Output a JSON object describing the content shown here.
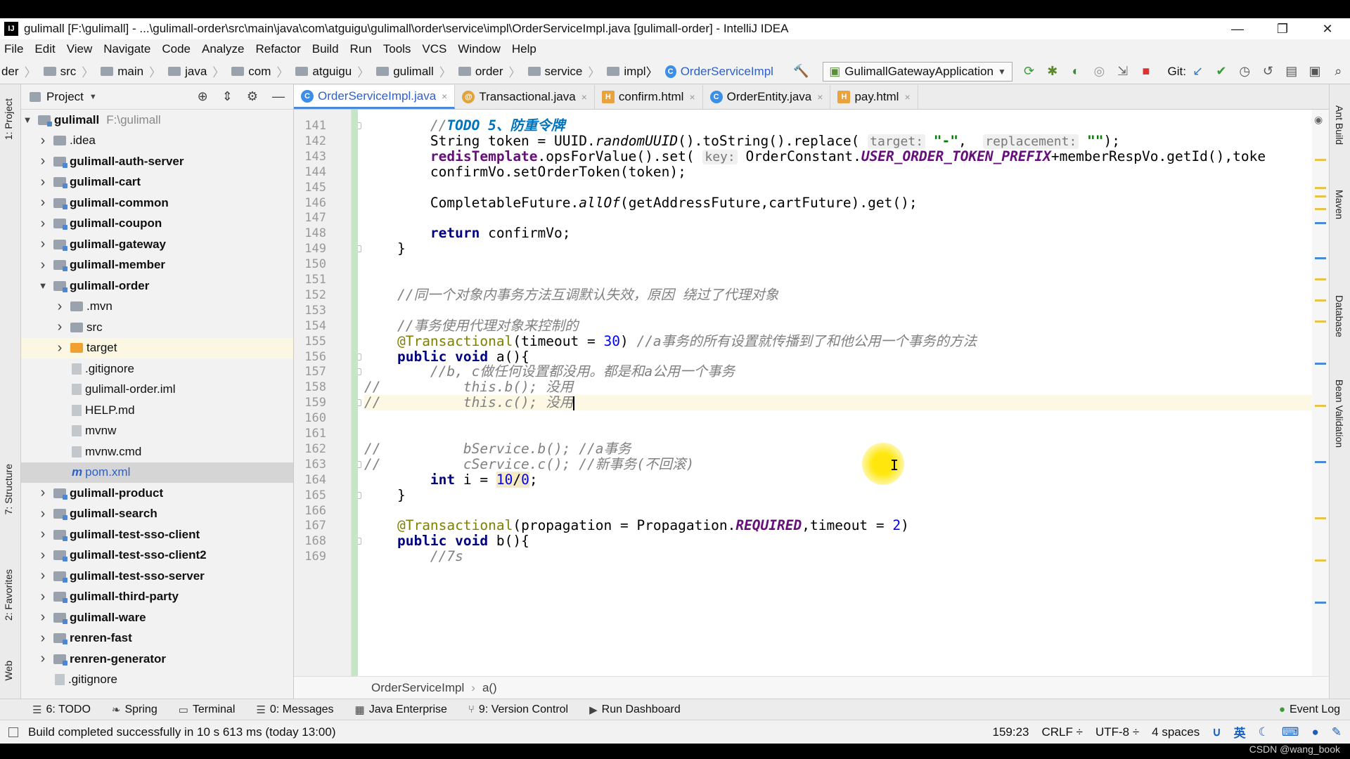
{
  "window": {
    "title": "gulimall [F:\\gulimall] - ...\\gulimall-order\\src\\main\\java\\com\\atguigu\\gulimall\\order\\service\\impl\\OrderServiceImpl.java [gulimall-order] - IntelliJ IDEA",
    "app_logo": "IJ",
    "minimize": "—",
    "restore": "❐",
    "close": "✕"
  },
  "menu": [
    "File",
    "Edit",
    "View",
    "Navigate",
    "Code",
    "Analyze",
    "Refactor",
    "Build",
    "Run",
    "Tools",
    "VCS",
    "Window",
    "Help"
  ],
  "nav": {
    "prefix": "der",
    "crumbs": [
      "src",
      "main",
      "java",
      "com",
      "atguigu",
      "gulimall",
      "order",
      "service",
      "impl"
    ],
    "current_class": "OrderServiceImpl",
    "run_config": "GulimallGatewayApplication",
    "git_label": "Git:"
  },
  "project": {
    "header": "Project",
    "root": {
      "name": "gulimall",
      "path": "F:\\gulimall"
    },
    "items": [
      {
        "label": ".idea",
        "kind": "folder",
        "level": 1
      },
      {
        "label": "gulimall-auth-server",
        "kind": "module",
        "level": 1
      },
      {
        "label": "gulimall-cart",
        "kind": "module",
        "level": 1
      },
      {
        "label": "gulimall-common",
        "kind": "module",
        "level": 1
      },
      {
        "label": "gulimall-coupon",
        "kind": "module",
        "level": 1
      },
      {
        "label": "gulimall-gateway",
        "kind": "module",
        "level": 1
      },
      {
        "label": "gulimall-member",
        "kind": "module",
        "level": 1
      },
      {
        "label": "gulimall-order",
        "kind": "module-open",
        "level": 1
      },
      {
        "label": ".mvn",
        "kind": "folder",
        "level": 2
      },
      {
        "label": "src",
        "kind": "folder",
        "level": 2
      },
      {
        "label": "target",
        "kind": "folder-orange",
        "level": 2
      },
      {
        "label": ".gitignore",
        "kind": "file",
        "level": 2
      },
      {
        "label": "gulimall-order.iml",
        "kind": "file",
        "level": 2
      },
      {
        "label": "HELP.md",
        "kind": "file",
        "level": 2
      },
      {
        "label": "mvnw",
        "kind": "file",
        "level": 2
      },
      {
        "label": "mvnw.cmd",
        "kind": "file",
        "level": 2
      },
      {
        "label": "pom.xml",
        "kind": "maven",
        "level": 2
      },
      {
        "label": "gulimall-product",
        "kind": "module",
        "level": 1
      },
      {
        "label": "gulimall-search",
        "kind": "module",
        "level": 1
      },
      {
        "label": "gulimall-test-sso-client",
        "kind": "module",
        "level": 1
      },
      {
        "label": "gulimall-test-sso-client2",
        "kind": "module",
        "level": 1
      },
      {
        "label": "gulimall-test-sso-server",
        "kind": "module",
        "level": 1
      },
      {
        "label": "gulimall-third-party",
        "kind": "module",
        "level": 1
      },
      {
        "label": "gulimall-ware",
        "kind": "module",
        "level": 1
      },
      {
        "label": "renren-fast",
        "kind": "module",
        "level": 1
      },
      {
        "label": "renren-generator",
        "kind": "module",
        "level": 1
      },
      {
        "label": ".gitignore",
        "kind": "file",
        "level": 1
      }
    ]
  },
  "tabs": [
    {
      "label": "OrderServiceImpl.java",
      "icon": "class-icon",
      "active": true
    },
    {
      "label": "Transactional.java",
      "icon": "annotation-icon",
      "active": false
    },
    {
      "label": "confirm.html",
      "icon": "html-icon",
      "active": false
    },
    {
      "label": "OrderEntity.java",
      "icon": "class-icon",
      "active": false
    },
    {
      "label": "pay.html",
      "icon": "html-icon",
      "active": false
    }
  ],
  "editor": {
    "lines": [
      {
        "n": "141",
        "html": "        <span class=\"cm\">//</span><span class=\"todo\">TODO 5、防重令牌</span>"
      },
      {
        "n": "142",
        "html": "        String token = UUID.<span class=\"it\">randomUUID</span>().toString().replace( <span class=\"hint\">target:</span> <span class=\"st\">\"-\"</span>,  <span class=\"hint\">replacement:</span> <span class=\"st\">\"\"</span>);"
      },
      {
        "n": "143",
        "html": "        <span class=\"fld\">redisTemplate</span>.opsForValue().set( <span class=\"hint\">key:</span> OrderConstant.<span class=\"cst\">USER_ORDER_TOKEN_PREFIX</span>+memberRespVo.getId(),toke"
      },
      {
        "n": "144",
        "html": "        confirmVo.setOrderToken(token);"
      },
      {
        "n": "145",
        "html": ""
      },
      {
        "n": "146",
        "html": "        CompletableFuture.<span class=\"it\">allOf</span>(getAddressFuture,cartFuture).get();"
      },
      {
        "n": "147",
        "html": ""
      },
      {
        "n": "148",
        "html": "        <span class=\"kw\">return</span> confirmVo;"
      },
      {
        "n": "149",
        "html": "    }"
      },
      {
        "n": "150",
        "html": ""
      },
      {
        "n": "151",
        "html": ""
      },
      {
        "n": "152",
        "html": "    <span class=\"cm\">//同一个对象内事务方法互调默认失效，原因 绕过了代理对象</span>"
      },
      {
        "n": "153",
        "html": ""
      },
      {
        "n": "154",
        "html": "    <span class=\"cm\">//事务使用代理对象来控制的</span>"
      },
      {
        "n": "155",
        "html": "    <span class=\"an\">@Transactional</span>(timeout = <span class=\"num\">30</span>) <span class=\"cm\">//a事务的所有设置就传播到了和他公用一个事务的方法</span>"
      },
      {
        "n": "156",
        "html": "    <span class=\"kw\">public void</span> a(){"
      },
      {
        "n": "157",
        "html": "        <span class=\"cm\">//b, c做任何设置都没用。都是和a公用一个事务</span>"
      },
      {
        "n": "158",
        "html": "<span class=\"cm\">//          this.b(); 没用</span>"
      },
      {
        "n": "159",
        "html": "<span class=\"cm\">//          this.c(); 没用</span><span class=\"caret\"></span>",
        "current": true
      },
      {
        "n": "160",
        "html": ""
      },
      {
        "n": "161",
        "html": ""
      },
      {
        "n": "162",
        "html": "<span class=\"cm\">//          bService.b(); //a事务</span>"
      },
      {
        "n": "163",
        "html": "<span class=\"cm\">//          cService.c(); //新事务(不回滚)</span>"
      },
      {
        "n": "164",
        "html": "        <span class=\"kw\">int</span> i = <span class=\"warnbg\"><span class=\"num\">10</span>/<span class=\"num\">0</span></span>;"
      },
      {
        "n": "165",
        "html": "    }"
      },
      {
        "n": "166",
        "html": ""
      },
      {
        "n": "167",
        "html": "    <span class=\"an\">@Transactional</span>(propagation = Propagation.<span class=\"cst\">REQUIRED</span>,timeout = <span class=\"num\">2</span>)"
      },
      {
        "n": "168",
        "html": "    <span class=\"kw\">public void</span> b(){"
      },
      {
        "n": "169",
        "html": "        <span class=\"cm\">//7s</span>"
      }
    ]
  },
  "editor_breadcrumb": [
    "OrderServiceImpl",
    "a()"
  ],
  "bottom_tools": [
    {
      "label": "6: TODO",
      "icon": "todo-icon"
    },
    {
      "label": "Spring",
      "icon": "spring-icon"
    },
    {
      "label": "Terminal",
      "icon": "terminal-icon"
    },
    {
      "label": "0: Messages",
      "icon": "messages-icon"
    },
    {
      "label": "Java Enterprise",
      "icon": "java-enterprise-icon"
    },
    {
      "label": "9: Version Control",
      "icon": "version-control-icon"
    },
    {
      "label": "Run Dashboard",
      "icon": "run-dashboard-icon"
    }
  ],
  "event_log": "Event Log",
  "status": {
    "message": "Build completed successfully in 10 s 613 ms (today 13:00)",
    "position": "159:23",
    "line_sep": "CRLF ÷",
    "encoding": "UTF-8 ÷",
    "indent": "4 spaces",
    "ime": "英"
  },
  "left_tool_tabs": [
    "1: Project",
    "7: Structure",
    "2: Favorites",
    "Web"
  ],
  "right_tool_tabs": [
    "Ant Build",
    "Maven",
    "Database",
    "Bean Validation"
  ],
  "watermark": "CSDN @wang_book",
  "colors": {
    "accent": "#4a88d8",
    "gutter_vcs": "#c6e4c6",
    "current_line": "#fdf8e4"
  }
}
